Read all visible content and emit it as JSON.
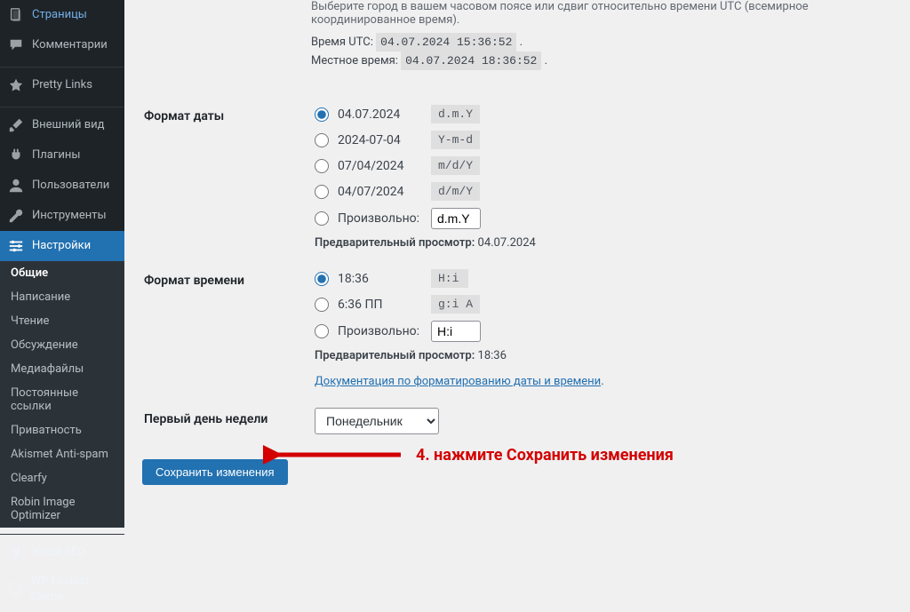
{
  "sidebar": {
    "main": [
      {
        "icon": "pages",
        "label": "Страницы"
      },
      {
        "icon": "comments",
        "label": "Комментарии"
      }
    ],
    "main2": [
      {
        "icon": "star",
        "label": "Pretty Links"
      }
    ],
    "main3": [
      {
        "icon": "brush",
        "label": "Внешний вид"
      },
      {
        "icon": "plug",
        "label": "Плагины"
      },
      {
        "icon": "user",
        "label": "Пользователи"
      },
      {
        "icon": "wrench",
        "label": "Инструменты"
      },
      {
        "icon": "sliders",
        "label": "Настройки",
        "current": true
      }
    ],
    "submenu": [
      {
        "label": "Общие",
        "current": true
      },
      {
        "label": "Написание"
      },
      {
        "label": "Чтение"
      },
      {
        "label": "Обсуждение"
      },
      {
        "label": "Медиафайлы"
      },
      {
        "label": "Постоянные ссылки"
      },
      {
        "label": "Приватность"
      },
      {
        "label": "Akismet Anti-spam"
      },
      {
        "label": "Clearfy"
      },
      {
        "label": "Robin Image Optimizer"
      }
    ],
    "tail": [
      {
        "icon": "yoast",
        "label": "Yoast SEO"
      },
      {
        "icon": "wpfc",
        "label": "WP Fastest Cache"
      }
    ]
  },
  "timezone": {
    "desc": "Выберите город в вашем часовом поясе или сдвиг относительно времени UTC (всемирное координированное время).",
    "utc_label": "Время UTC:",
    "utc_value": "04.07.2024 15:36:52",
    "local_label": "Местное время:",
    "local_value": "04.07.2024 18:36:52"
  },
  "date_format": {
    "heading": "Формат даты",
    "options": [
      {
        "display": "04.07.2024",
        "code": "d.m.Y",
        "checked": true
      },
      {
        "display": "2024-07-04",
        "code": "Y-m-d"
      },
      {
        "display": "07/04/2024",
        "code": "m/d/Y"
      },
      {
        "display": "04/07/2024",
        "code": "d/m/Y"
      }
    ],
    "custom_label": "Произвольно:",
    "custom_value": "d.m.Y",
    "preview_label": "Предварительный просмотр:",
    "preview_value": "04.07.2024"
  },
  "time_format": {
    "heading": "Формат времени",
    "options": [
      {
        "display": "18:36",
        "code": "H:i",
        "checked": true
      },
      {
        "display": "6:36 ПП",
        "code": "g:i A"
      }
    ],
    "custom_label": "Произвольно:",
    "custom_value": "H:i",
    "preview_label": "Предварительный просмотр:",
    "preview_value": "18:36",
    "doc_link": "Документация по форматированию даты и времени"
  },
  "week_start": {
    "heading": "Первый день недели",
    "value": "Понедельник"
  },
  "submit_label": "Сохранить изменения",
  "annotation": "4. нажмите  Сохранить изменения"
}
